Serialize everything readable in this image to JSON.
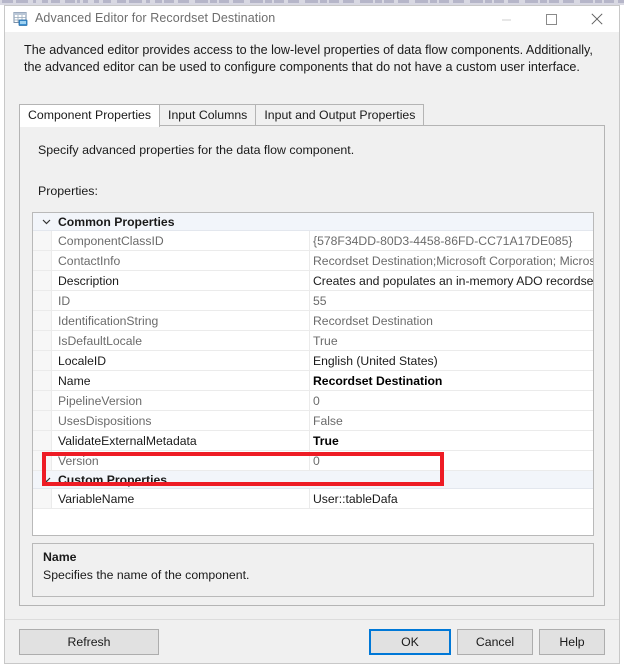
{
  "window": {
    "title": "Advanced Editor for Recordset Destination",
    "icon": "recordset-destination-icon",
    "controls": {
      "minimize": "minimize-icon",
      "maximize": "maximize-icon",
      "close": "close-icon"
    }
  },
  "intro_text": "The advanced editor provides access to the low-level properties of data flow components. Additionally, the advanced editor can be used to configure components that do not have a custom user interface.",
  "tabs": [
    {
      "label": "Component Properties",
      "active": true
    },
    {
      "label": "Input Columns",
      "active": false
    },
    {
      "label": "Input and Output Properties",
      "active": false
    }
  ],
  "page": {
    "hint": "Specify advanced properties for the data flow component.",
    "properties_label": "Properties:"
  },
  "grid": {
    "categories": [
      {
        "name": "Common Properties",
        "expanded": true,
        "rows": [
          {
            "name": "ComponentClassID",
            "value": "{578F34DD-80D3-4458-86FD-CC71A17DE085}",
            "editable": false,
            "bold": false
          },
          {
            "name": "ContactInfo",
            "value": "Recordset Destination;Microsoft Corporation; Microsoft SQ",
            "editable": false,
            "bold": false
          },
          {
            "name": "Description",
            "value": "Creates and populates an in-memory ADO recordset that i",
            "editable": true,
            "bold": false
          },
          {
            "name": "ID",
            "value": "55",
            "editable": false,
            "bold": false
          },
          {
            "name": "IdentificationString",
            "value": "Recordset Destination",
            "editable": false,
            "bold": false
          },
          {
            "name": "IsDefaultLocale",
            "value": "True",
            "editable": false,
            "bold": false
          },
          {
            "name": "LocaleID",
            "value": "English (United States)",
            "editable": true,
            "bold": false
          },
          {
            "name": "Name",
            "value": "Recordset Destination",
            "editable": true,
            "bold": true
          },
          {
            "name": "PipelineVersion",
            "value": "0",
            "editable": false,
            "bold": false
          },
          {
            "name": "UsesDispositions",
            "value": "False",
            "editable": false,
            "bold": false
          },
          {
            "name": "ValidateExternalMetadata",
            "value": "True",
            "editable": true,
            "bold": true
          },
          {
            "name": "Version",
            "value": "0",
            "editable": false,
            "bold": false
          }
        ]
      },
      {
        "name": "Custom Properties",
        "expanded": true,
        "rows": [
          {
            "name": "VariableName",
            "value": "User::tableDafa",
            "editable": true,
            "bold": false
          }
        ]
      }
    ],
    "highlight_color": "#ee1c25"
  },
  "description_panel": {
    "title": "Name",
    "text": "Specifies the name of the component."
  },
  "footer": {
    "refresh": "Refresh",
    "ok": "OK",
    "cancel": "Cancel",
    "help": "Help",
    "default_button_accent": "#0078d7"
  }
}
